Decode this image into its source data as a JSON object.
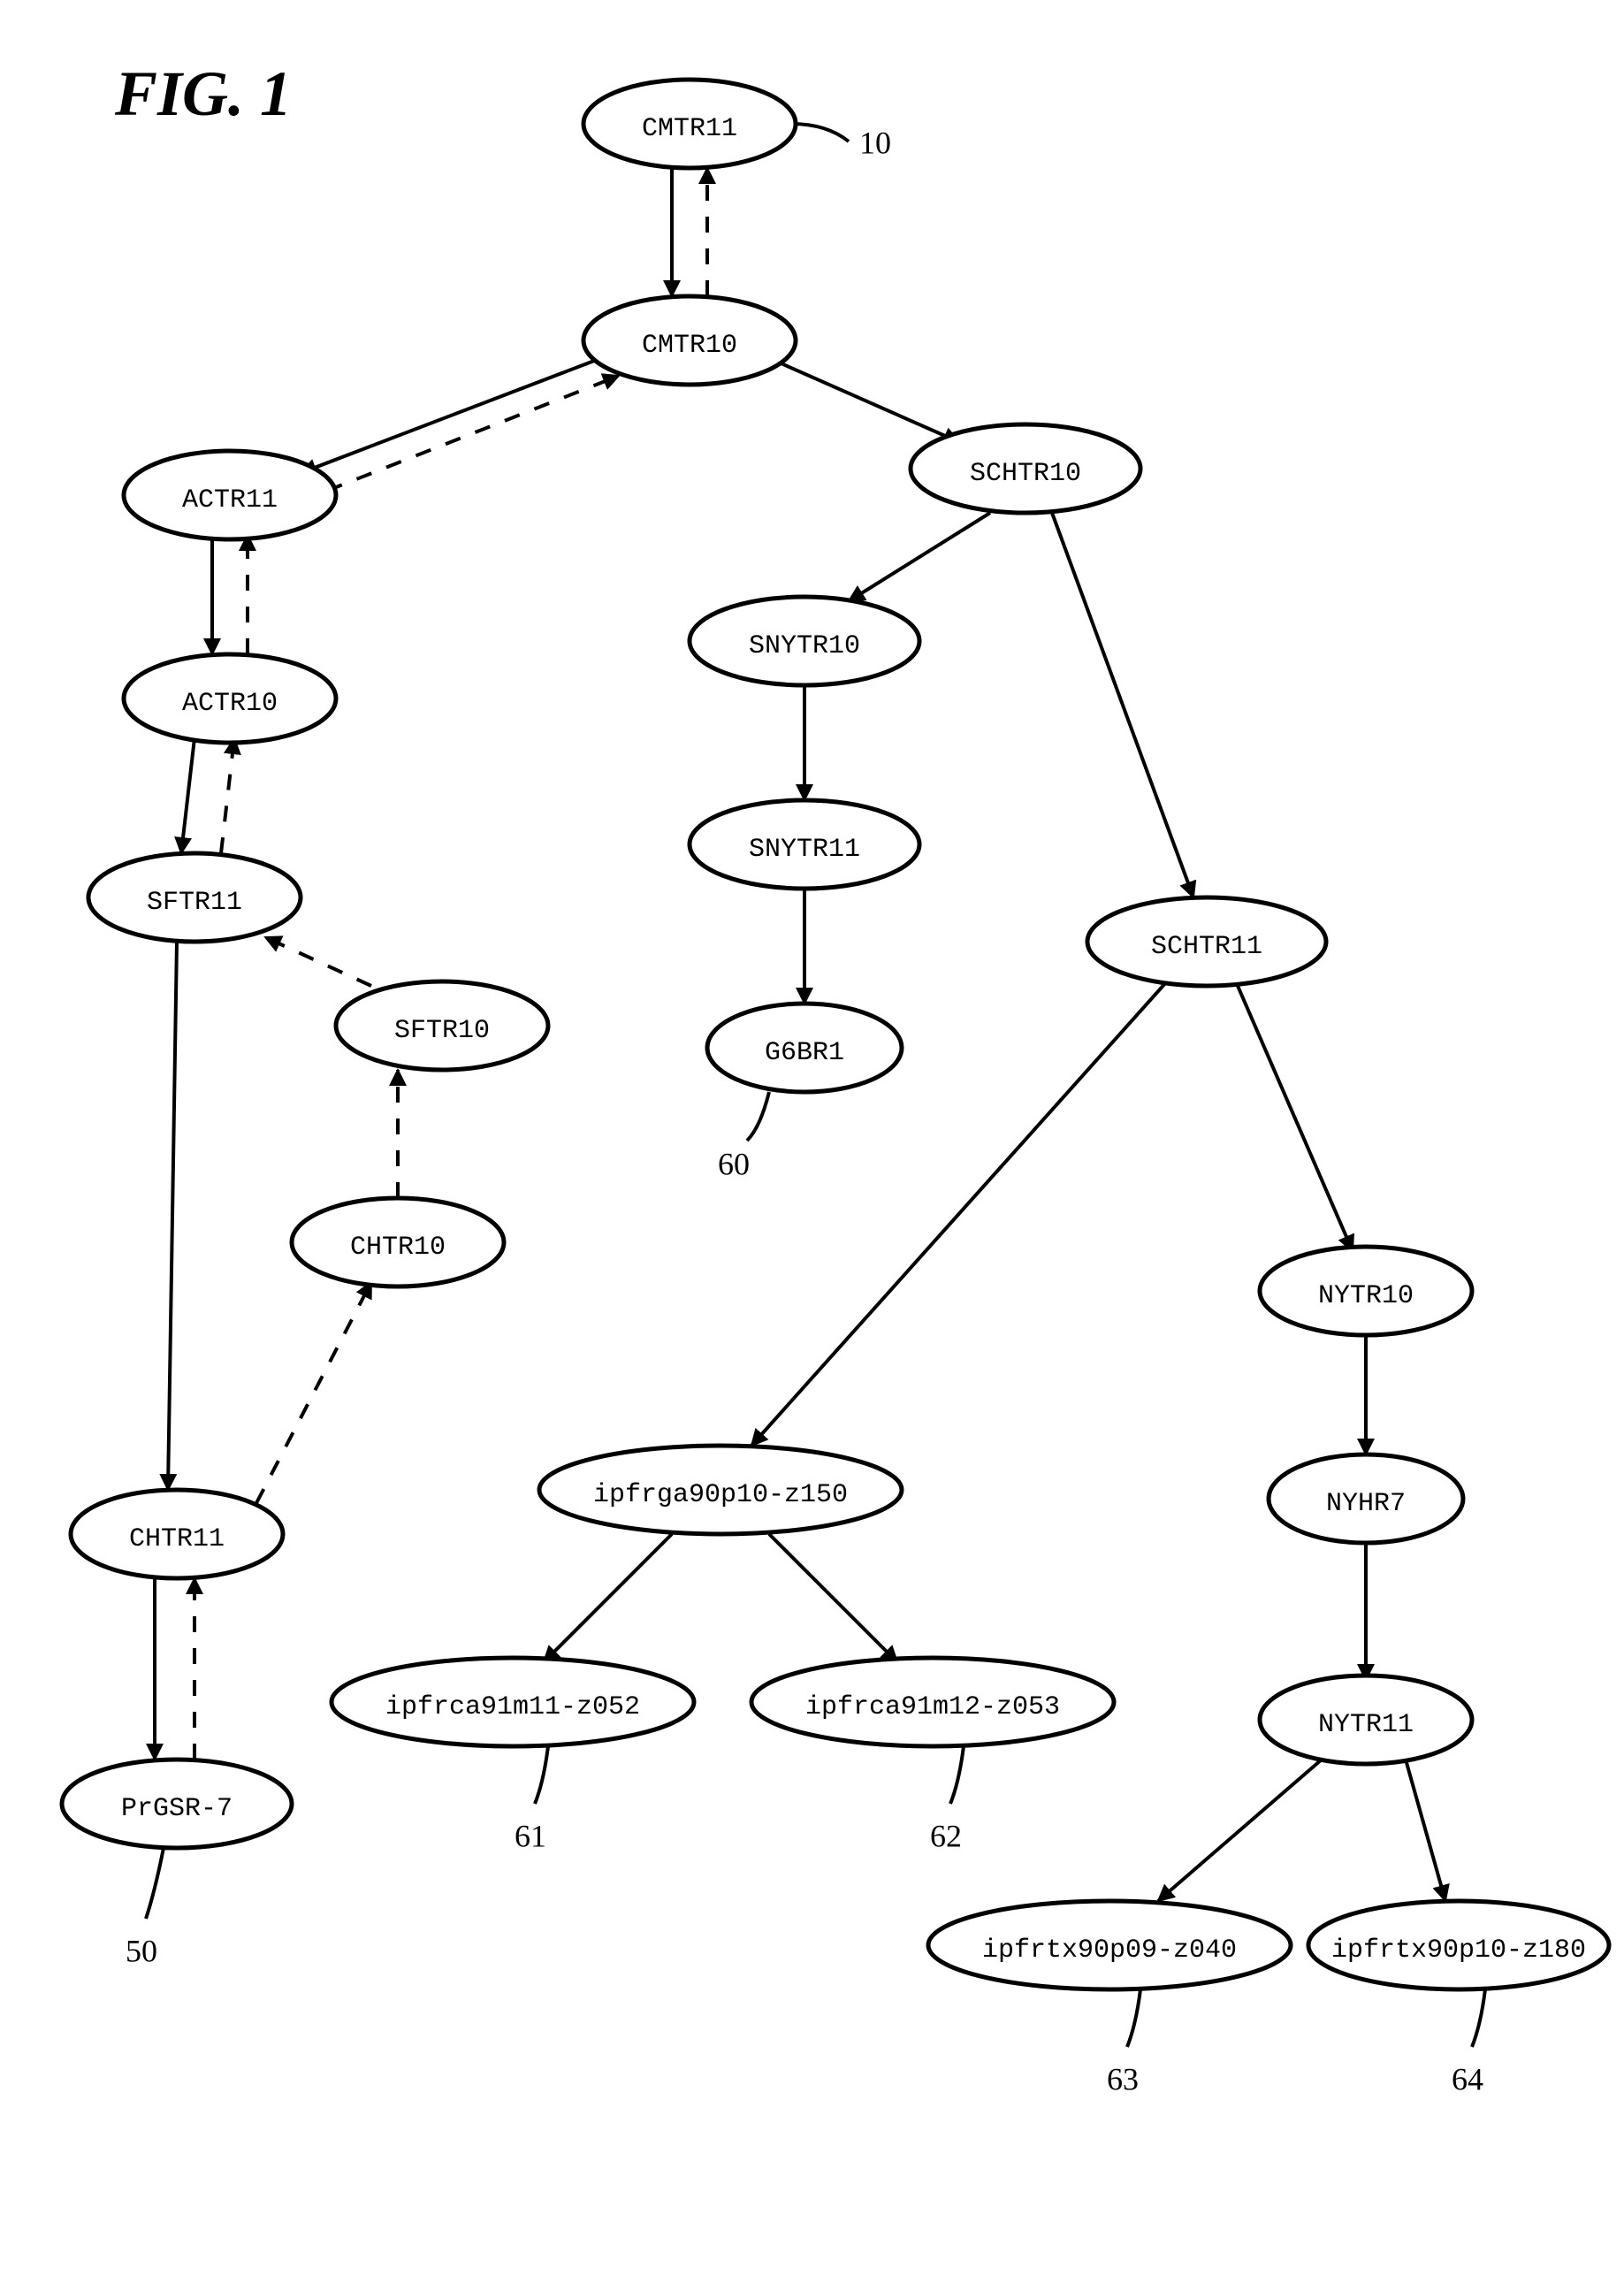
{
  "figure_title": "FIG. 1",
  "nodes": {
    "cmtr11": {
      "label": "CMTR11"
    },
    "cmtr10": {
      "label": "CMTR10"
    },
    "actr11": {
      "label": "ACTR11"
    },
    "actr10": {
      "label": "ACTR10"
    },
    "sftr11": {
      "label": "SFTR11"
    },
    "sftr10": {
      "label": "SFTR10"
    },
    "chtr10": {
      "label": "CHTR10"
    },
    "chtr11": {
      "label": "CHTR11"
    },
    "prgsr7": {
      "label": "PrGSR-7"
    },
    "schtr10": {
      "label": "SCHTR10"
    },
    "snytr10": {
      "label": "SNYTR10"
    },
    "snytr11": {
      "label": "SNYTR11"
    },
    "g6br1": {
      "label": "G6BR1"
    },
    "schtr11": {
      "label": "SCHTR11"
    },
    "z150": {
      "label": "ipfrga90p10-z150"
    },
    "z052": {
      "label": "ipfrca91m11-z052"
    },
    "z053": {
      "label": "ipfrca91m12-z053"
    },
    "nytr10": {
      "label": "NYTR10"
    },
    "nyhr7": {
      "label": "NYHR7"
    },
    "nytr11": {
      "label": "NYTR11"
    },
    "z040": {
      "label": "ipfrtx90p09-z040"
    },
    "z180": {
      "label": "ipfrtx90p10-z180"
    }
  },
  "refs": {
    "r10": "10",
    "r60": "60",
    "r50": "50",
    "r61": "61",
    "r62": "62",
    "r63": "63",
    "r64": "64"
  }
}
